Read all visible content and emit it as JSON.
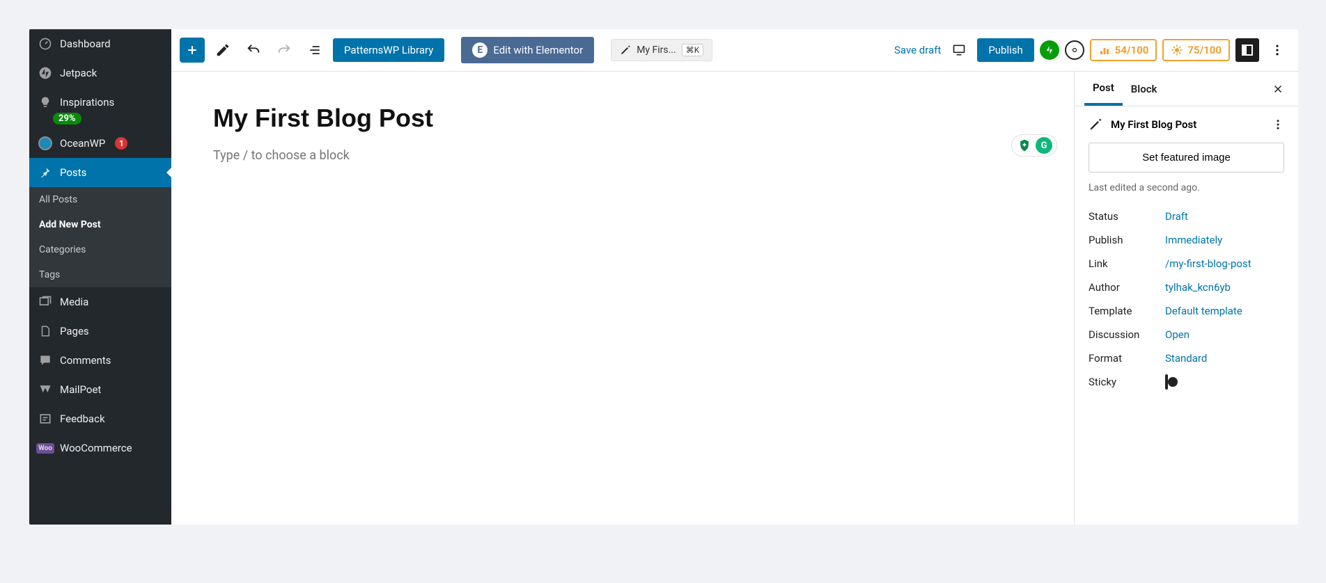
{
  "sidebar": {
    "dashboard": "Dashboard",
    "jetpack": "Jetpack",
    "inspirations": "Inspirations",
    "inspirations_pct": "29%",
    "oceanwp": "OceanWP",
    "oceanwp_n": "1",
    "posts": "Posts",
    "all_posts": "All Posts",
    "add_new": "Add New Post",
    "categories": "Categories",
    "tags": "Tags",
    "media": "Media",
    "pages": "Pages",
    "comments": "Comments",
    "mailpoet": "MailPoet",
    "feedback": "Feedback",
    "woo": "WooCommerce"
  },
  "toolbar": {
    "patterns": "PatternsWP Library",
    "elementor": "Edit with Elementor",
    "breadcrumb": "My Firs...",
    "breadcrumb_kbd": "⌘K",
    "save_draft": "Save draft",
    "publish": "Publish",
    "seo1": "54/100",
    "seo2": "75/100"
  },
  "content": {
    "title": "My First Blog Post",
    "placeholder": "Type / to choose a block"
  },
  "panel": {
    "tab_post": "Post",
    "tab_block": "Block",
    "post_title": "My First Blog Post",
    "featured": "Set featured image",
    "last_edit": "Last edited a second ago.",
    "rows": {
      "status_k": "Status",
      "status_v": "Draft",
      "publish_k": "Publish",
      "publish_v": "Immediately",
      "link_k": "Link",
      "link_v": "/my-first-blog-post",
      "author_k": "Author",
      "author_v": "tylhak_kcn6yb",
      "template_k": "Template",
      "template_v": "Default template",
      "discussion_k": "Discussion",
      "discussion_v": "Open",
      "format_k": "Format",
      "format_v": "Standard",
      "sticky_k": "Sticky"
    }
  }
}
